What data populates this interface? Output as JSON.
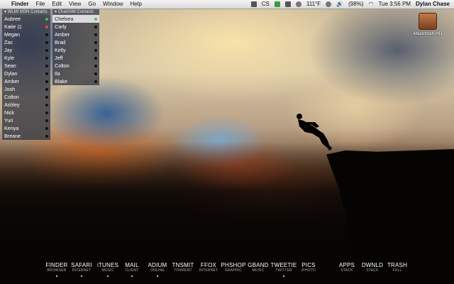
{
  "menubar": {
    "app_name": "Finder",
    "menus": [
      "File",
      "Edit",
      "View",
      "Go",
      "Window",
      "Help"
    ],
    "status": {
      "cs": "CS",
      "temperature": "111°F",
      "battery": "(98%)",
      "datetime": "Tue 3:56 PM",
      "user": "Dylan Chase"
    }
  },
  "wlm": {
    "title": "WLM/ MSN Contacts",
    "contacts": [
      {
        "name": "Aubree",
        "status_color": "#4fc04f"
      },
      {
        "name": "Katie ⊡",
        "status_color": "#e24b4b"
      },
      {
        "name": "Megan",
        "status_color": "#111111"
      },
      {
        "name": "Zac",
        "status_color": "#111111"
      },
      {
        "name": "Jay",
        "status_color": "#111111"
      },
      {
        "name": "Kyle",
        "status_color": "#111111"
      },
      {
        "name": "Sean",
        "status_color": "#111111"
      },
      {
        "name": "Dylan",
        "status_color": "#111111"
      },
      {
        "name": "Amber",
        "status_color": "#111111"
      },
      {
        "name": "Josh",
        "status_color": "#111111"
      },
      {
        "name": "Colton",
        "status_color": "#111111"
      },
      {
        "name": "Ashley",
        "status_color": "#111111"
      },
      {
        "name": "Nick",
        "status_color": "#111111"
      },
      {
        "name": "Yuri",
        "status_color": "#111111"
      },
      {
        "name": "Kenya",
        "status_color": "#111111"
      },
      {
        "name": "Breane",
        "status_color": "#111111"
      }
    ]
  },
  "aim": {
    "title": "Chat/AIM Contacts",
    "contacts": [
      {
        "name": "Chelsea",
        "status_color": "#4fc04f",
        "selected": true
      },
      {
        "name": "Carly",
        "status_color": "#111111"
      },
      {
        "name": "Amber",
        "status_color": "#111111"
      },
      {
        "name": "Brad",
        "status_color": "#111111"
      },
      {
        "name": "Kelly",
        "status_color": "#111111"
      },
      {
        "name": "Jeff",
        "status_color": "#111111"
      },
      {
        "name": "Colton",
        "status_color": "#111111"
      },
      {
        "name": "Ila",
        "status_color": "#111111"
      },
      {
        "name": "Blake",
        "status_color": "#111111"
      }
    ]
  },
  "desktop": {
    "hd_label": "Macintosh HD"
  },
  "dock": [
    {
      "label": "FINDER",
      "sub": "BROWSER",
      "running": true
    },
    {
      "label": "SAFARI",
      "sub": "INTERNET",
      "running": true
    },
    {
      "label": "iTUNES",
      "sub": "MUSIC",
      "running": true
    },
    {
      "label": "MAIL",
      "sub": "CLIENT",
      "running": true
    },
    {
      "label": "ADIUM",
      "sub": "ONLINE",
      "running": true
    },
    {
      "label": "TNSMIT",
      "sub": "TORRENT",
      "running": false
    },
    {
      "label": "FFOX",
      "sub": "INTERNET",
      "running": false
    },
    {
      "label": "PHSHOP",
      "sub": "GRAPHIC",
      "running": false
    },
    {
      "label": "GBAND",
      "sub": "MUSIC",
      "running": false
    },
    {
      "label": "TWEETIE",
      "sub": "TWITTER",
      "running": true
    },
    {
      "label": "PICS",
      "sub": "iPHOTO",
      "running": false
    },
    {
      "label": "APPS",
      "sub": "STACK",
      "running": false
    },
    {
      "label": "DWNLD",
      "sub": "STACK",
      "running": false
    },
    {
      "label": "TRASH",
      "sub": "FULL",
      "running": false
    }
  ]
}
